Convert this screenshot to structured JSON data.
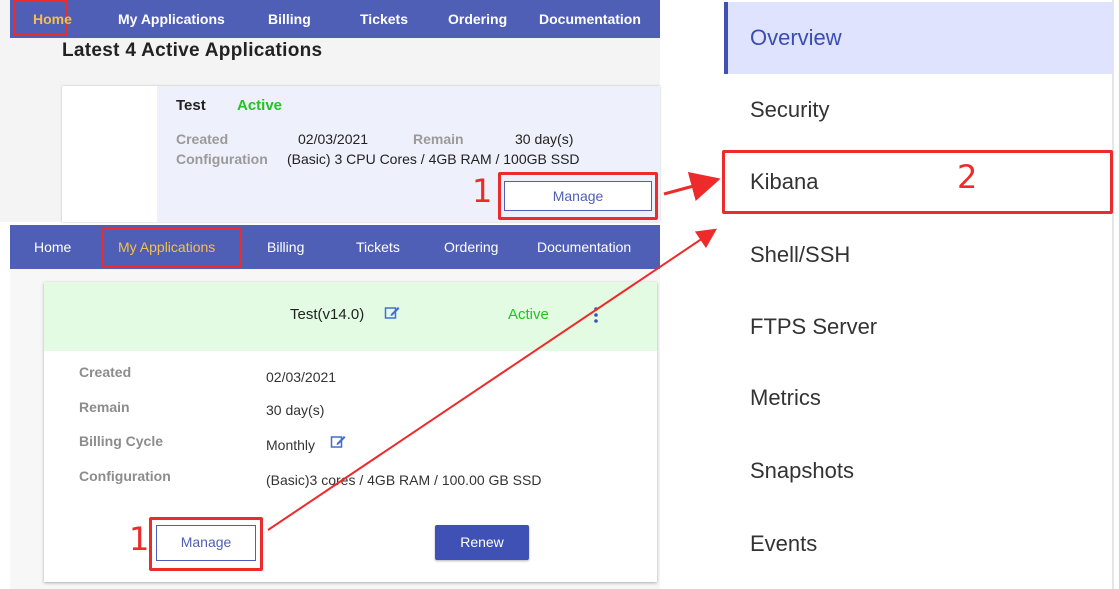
{
  "panel_a": {
    "nav": [
      "Home",
      "My Applications",
      "Billing",
      "Tickets",
      "Ordering",
      "Documentation"
    ],
    "title": "Latest 4 Active Applications",
    "app": {
      "name": "Test",
      "status": "Active",
      "created_label": "Created",
      "created": "02/03/2021",
      "remain_label": "Remain",
      "remain": "30 day(s)",
      "config_label": "Configuration",
      "config": "(Basic) 3 CPU Cores / 4GB RAM / 100GB SSD",
      "manage": "Manage"
    }
  },
  "panel_b": {
    "nav": [
      "Home",
      "My Applications",
      "Billing",
      "Tickets",
      "Ordering",
      "Documentation"
    ],
    "app": {
      "name": "Test(v14.0)",
      "status": "Active",
      "created_label": "Created",
      "created": "02/03/2021",
      "remain_label": "Remain",
      "remain": "30 day(s)",
      "billing_label": "Billing Cycle",
      "billing": "Monthly",
      "config_label": "Configuration",
      "config": "(Basic)3 cores / 4GB RAM / 100.00 GB SSD",
      "manage": "Manage",
      "renew": "Renew"
    }
  },
  "sidebar": {
    "items": [
      "Overview",
      "Security",
      "Kibana",
      "Shell/SSH",
      "FTPS Server",
      "Metrics",
      "Snapshots",
      "Events"
    ],
    "active": "Overview"
  },
  "annotations": {
    "step1": "1",
    "step2": "2"
  },
  "colors": {
    "nav": "#4f5fb6",
    "highlight": "#ee2b2b",
    "active_green": "#22c322",
    "menu_active_bg": "#dfe3fd"
  }
}
